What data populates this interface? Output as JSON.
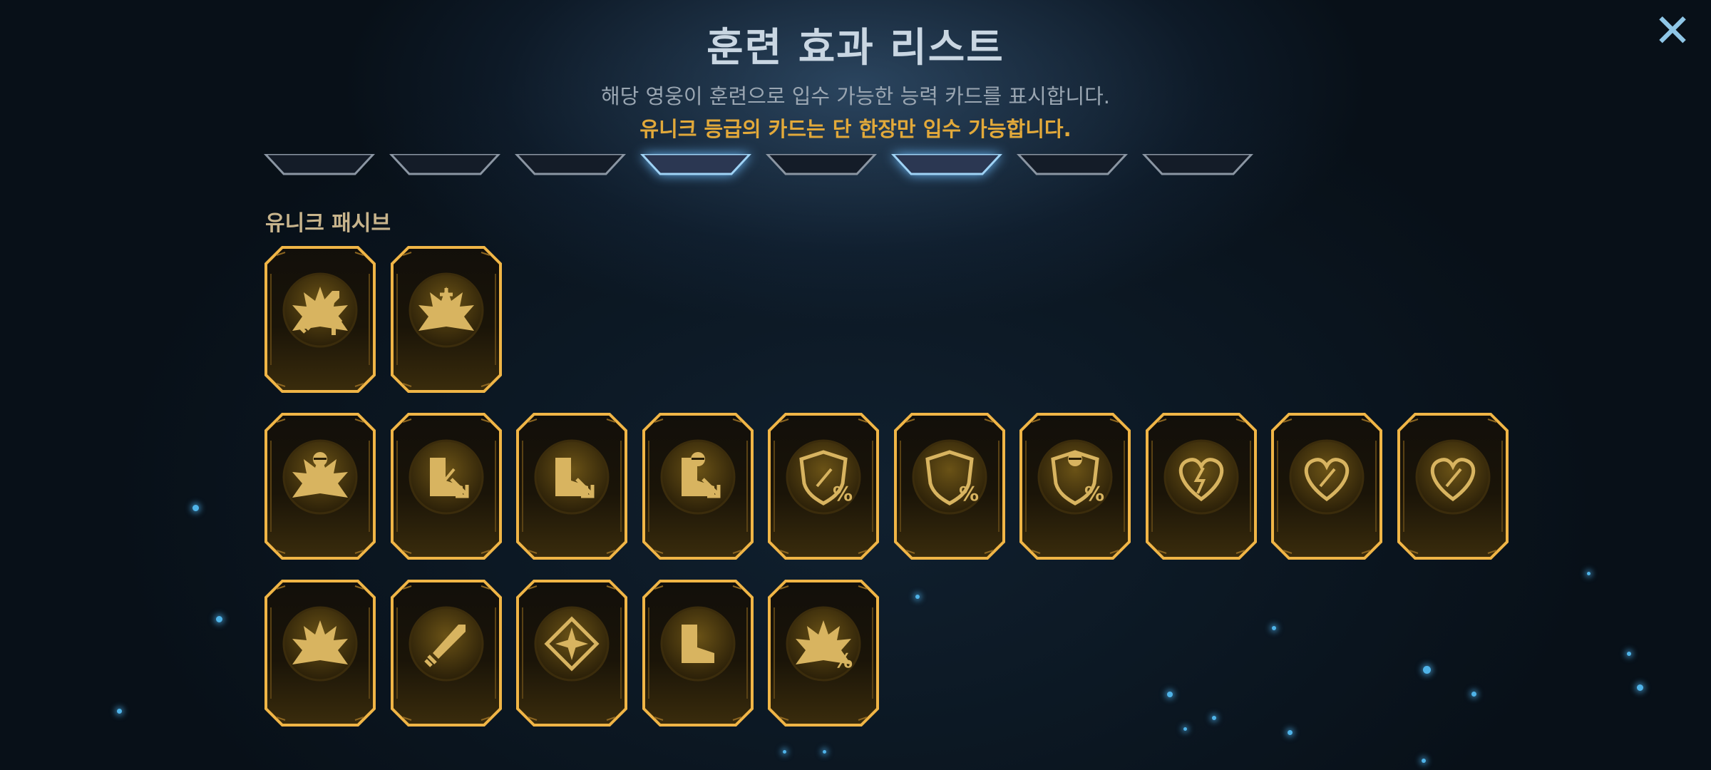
{
  "header": {
    "title": "훈련 효과 리스트",
    "subtitle": "해당 영웅이 훈련으로 입수 가능한 능력 카드를 표시합니다.",
    "notice": "유니크 등급의 카드는 단 한장만 입수 가능합니다.",
    "close_icon": "close-x-icon",
    "colors": {
      "notice": "#e2a93a",
      "close": "#8fc6e6"
    }
  },
  "top_cards": [
    {
      "selected": false
    },
    {
      "selected": false
    },
    {
      "selected": false
    },
    {
      "selected": true
    },
    {
      "selected": false
    },
    {
      "selected": true
    },
    {
      "selected": false
    },
    {
      "selected": false
    }
  ],
  "section": {
    "label": "유니크 패시브"
  },
  "unique_cards": [
    {
      "icon": "explosion-sword-up-icon"
    },
    {
      "icon": "heart-plus-explosion-icon"
    }
  ],
  "cards_row2": [
    {
      "icon": "power-explosion-icon"
    },
    {
      "icon": "boot-sword-down-icon"
    },
    {
      "icon": "boot-heart-down-icon"
    },
    {
      "icon": "boot-power-down-icon"
    },
    {
      "icon": "shield-sword-percent-icon"
    },
    {
      "icon": "shield-heart-percent-icon"
    },
    {
      "icon": "shield-power-percent-icon"
    },
    {
      "icon": "heart-shield-bolt-icon"
    },
    {
      "icon": "heart-shield-sword-icon"
    },
    {
      "icon": "heart-shield-sword-alt-icon"
    }
  ],
  "cards_row3": [
    {
      "icon": "explosion-burst-icon"
    },
    {
      "icon": "sword-icon"
    },
    {
      "icon": "crosshair-diamond-icon"
    },
    {
      "icon": "boot-speed-icon"
    },
    {
      "icon": "explosion-percent-icon"
    }
  ]
}
